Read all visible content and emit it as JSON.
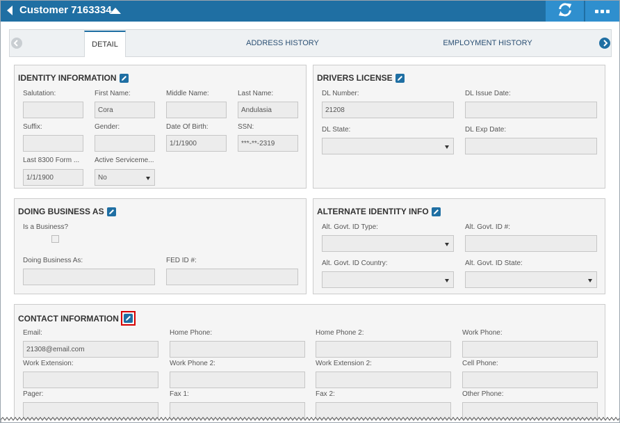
{
  "header": {
    "title": "Customer 7163334",
    "colors": {
      "bar": "#1f6fa3",
      "button": "#2f8fce"
    }
  },
  "tabs": [
    {
      "label": "DETAIL",
      "active": true
    },
    {
      "label": "ADDRESS HISTORY",
      "active": false
    },
    {
      "label": "EMPLOYMENT HISTORY",
      "active": false
    }
  ],
  "identity": {
    "title": "IDENTITY INFORMATION",
    "salutation": {
      "label": "Salutation:",
      "value": ""
    },
    "first_name": {
      "label": "First Name:",
      "value": "Cora"
    },
    "middle_name": {
      "label": "Middle Name:",
      "value": ""
    },
    "last_name": {
      "label": "Last Name:",
      "value": "Andulasia"
    },
    "suffix": {
      "label": "Suffix:",
      "value": ""
    },
    "gender": {
      "label": "Gender:",
      "value": ""
    },
    "dob": {
      "label": "Date Of Birth:",
      "value": "1/1/1900"
    },
    "ssn": {
      "label": "SSN:",
      "value": "***-**-2319"
    },
    "form8300": {
      "label": "Last 8300 Form ...",
      "value": "1/1/1900"
    },
    "servicemember": {
      "label": "Active Serviceme...",
      "value": "No"
    }
  },
  "drivers_license": {
    "title": "DRIVERS LICENSE",
    "dl_number": {
      "label": "DL Number:",
      "value": "21208"
    },
    "dl_issue_date": {
      "label": "DL Issue Date:",
      "value": ""
    },
    "dl_state": {
      "label": "DL State:",
      "value": ""
    },
    "dl_exp_date": {
      "label": "DL Exp Date:",
      "value": ""
    }
  },
  "dba": {
    "title": "DOING BUSINESS AS",
    "is_business": {
      "label": "Is a Business?",
      "checked": false
    },
    "dba_name": {
      "label": "Doing Business As:",
      "value": ""
    },
    "fed_id": {
      "label": "FED ID #:",
      "value": ""
    }
  },
  "alt_identity": {
    "title": "ALTERNATE IDENTITY INFO",
    "id_type": {
      "label": "Alt. Govt. ID Type:",
      "value": ""
    },
    "id_number": {
      "label": "Alt. Govt. ID #:",
      "value": ""
    },
    "id_country": {
      "label": "Alt. Govt. ID Country:",
      "value": ""
    },
    "id_state": {
      "label": "Alt. Govt. ID State:",
      "value": ""
    }
  },
  "contact": {
    "title": "CONTACT INFORMATION",
    "email": {
      "label": "Email:",
      "value": "21308@email.com"
    },
    "home_phone": {
      "label": "Home Phone:",
      "value": ""
    },
    "home_phone2": {
      "label": "Home Phone 2:",
      "value": ""
    },
    "work_phone": {
      "label": "Work Phone:",
      "value": ""
    },
    "work_ext": {
      "label": "Work Extension:",
      "value": ""
    },
    "work_phone2": {
      "label": "Work Phone 2:",
      "value": ""
    },
    "work_ext2": {
      "label": "Work Extension 2:",
      "value": ""
    },
    "cell_phone": {
      "label": "Cell Phone:",
      "value": ""
    },
    "pager": {
      "label": "Pager:",
      "value": ""
    },
    "fax1": {
      "label": "Fax 1:",
      "value": ""
    },
    "fax2": {
      "label": "Fax 2:",
      "value": ""
    },
    "other_phone": {
      "label": "Other Phone:",
      "value": ""
    }
  }
}
